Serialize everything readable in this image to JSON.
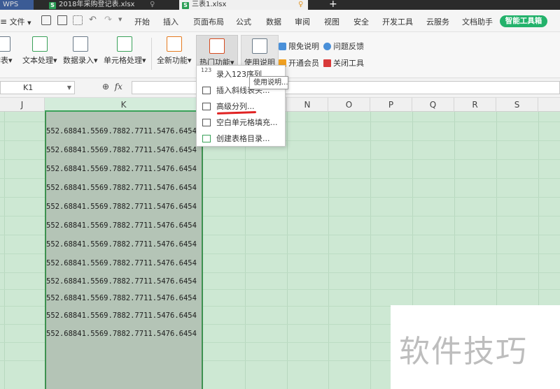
{
  "tabs": {
    "wps": "WPS",
    "file1": "2018年采购登记表.xlsx",
    "file2": "三表1.xlsx",
    "new_tab": "+"
  },
  "menu": {
    "file": "文件",
    "items": [
      "开始",
      "插入",
      "页面布局",
      "公式",
      "数据",
      "审阅",
      "视图",
      "安全",
      "开发工具",
      "云服务",
      "文档助手"
    ],
    "smart_toolbox": "智能工具箱"
  },
  "ribbon": {
    "left_cut": "作表",
    "text_processing": "文本处理",
    "data_entry": "数据录入",
    "cell_process": "单元格处理",
    "all_functions": "全新功能",
    "hot_functions": "热门功能",
    "usage_guide": "使用说明",
    "disclaimer": "限免说明",
    "feedback": "问题反馈",
    "vip": "开通会员",
    "close_tool": "关闭工具"
  },
  "formula_bar": {
    "cell_ref": "K1",
    "fx": "fx"
  },
  "columns": [
    "J",
    "K",
    "N",
    "O",
    "P",
    "Q",
    "R",
    "S"
  ],
  "cells": [
    "552.68841.5569.7882.7711.5476.6454",
    "552.68841.5569.7882.7711.5476.6454",
    "552.68841.5569.7882.7711.5476.6454",
    "552.68841.5569.7882.7711.5476.6454",
    "552.68841.5569.7882.7711.5476.6454",
    "552.68841.5569.7882.7711.5476.6454",
    "552.68841.5569.7882.7711.5476.6454",
    "552.68841.5569.7882.7711.5476.6454",
    "552.68841.5569.7882.7711.5476.6454",
    "552.68841.5569.7882.7711.5476.6454",
    "552.68841.5569.7882.7711.5476.6454",
    "552.68841.5569.7882.7711.5476.6454"
  ],
  "dropdown": {
    "items": [
      "录入123序列",
      "插入斜线表头...",
      "高级分列...",
      "空白单元格填充...",
      "创建表格目录..."
    ],
    "num_icon": "123"
  },
  "tooltip": "使用说明...",
  "watermark": "软件技巧",
  "colors": {
    "accent_green": "#23b26b",
    "selection_fill": "#cde8d3",
    "selected_column": "#b4c4b6",
    "underline_red": "#e02222"
  }
}
